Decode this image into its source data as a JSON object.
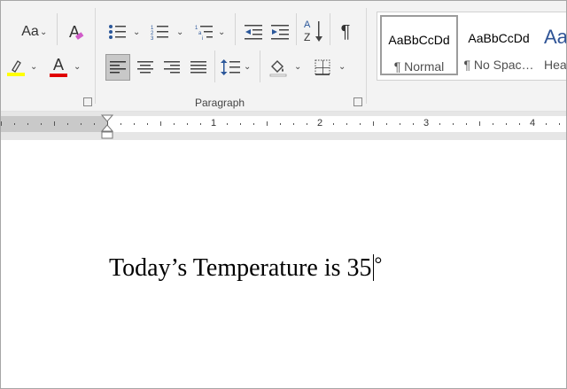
{
  "ribbon": {
    "font_group": {
      "change_case_label": "Aa",
      "clear_format_label": "A",
      "font_color_label": "A",
      "font_color": "#e00000",
      "highlight_color": "#ffff00"
    },
    "paragraph_group": {
      "label": "Paragraph",
      "sort_label_top": "A",
      "sort_label_bottom": "Z",
      "show_marks_label": "¶"
    },
    "styles_group": {
      "styles": [
        {
          "sample": "AaBbCcDd",
          "name": "¶ Normal",
          "selected": true
        },
        {
          "sample": "AaBbCcDd",
          "name": "¶ No Spac…",
          "selected": false
        },
        {
          "sample": "Aa",
          "name": "Hea",
          "selected": false
        }
      ],
      "heading_color": "#2f5496"
    },
    "colors": {
      "accent_active": "#c8c8c8",
      "icon_blue": "#2b579a"
    }
  },
  "ruler": {
    "numbers": [
      "1",
      "2",
      "3",
      "4"
    ]
  },
  "document": {
    "text": "Today’s Temperature is 35",
    "after_cursor": "°"
  }
}
